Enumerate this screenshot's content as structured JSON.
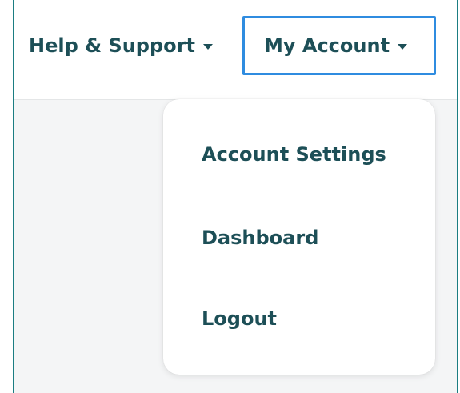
{
  "nav": {
    "help_label": "Help & Support",
    "account_label": "My Account"
  },
  "dropdown": {
    "items": [
      {
        "label": "Account Settings"
      },
      {
        "label": "Dashboard"
      },
      {
        "label": "Logout"
      }
    ]
  },
  "icons": {
    "help_caret": "caret-down-icon",
    "account_caret": "caret-down-icon"
  },
  "colors": {
    "text": "#1d4f57",
    "frame_border": "#1b7d82",
    "focus_outline": "#2f8ce0",
    "content_bg": "#f4f5f6"
  }
}
